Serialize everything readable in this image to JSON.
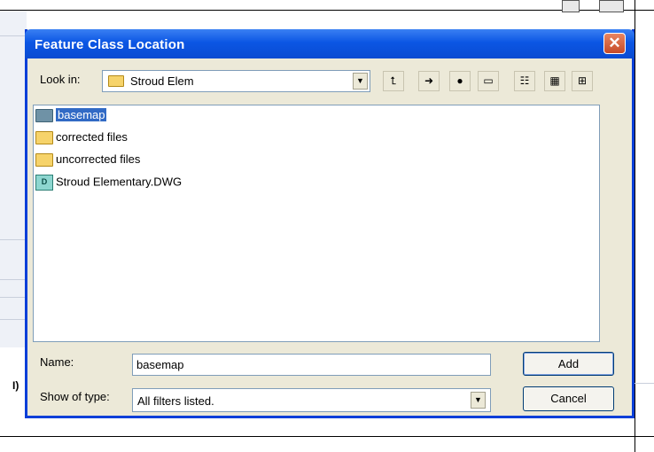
{
  "dialog": {
    "title": "Feature Class Location",
    "close_glyph": "✕"
  },
  "look_in": {
    "label": "Look in:",
    "value": "Stroud Elem",
    "icon": "folder-icon"
  },
  "toolbar": [
    {
      "name": "up-one-level-icon",
      "glyph": "⮤"
    },
    {
      "name": "connect-folder-icon",
      "glyph": "➜"
    },
    {
      "name": "disconnect-folder-icon",
      "glyph": "●"
    },
    {
      "name": "new-folder-icon",
      "glyph": "▭"
    },
    {
      "name": "list-view-icon",
      "glyph": "☷"
    },
    {
      "name": "details-view-icon",
      "glyph": "▦"
    },
    {
      "name": "thumbnails-view-icon",
      "glyph": "⊞"
    }
  ],
  "files": [
    {
      "name": "basemap",
      "type": "folder",
      "selected": true
    },
    {
      "name": "corrected files",
      "type": "folder",
      "selected": false
    },
    {
      "name": "uncorrected files",
      "type": "folder",
      "selected": false
    },
    {
      "name": "Stroud Elementary.DWG",
      "type": "dwg",
      "selected": false
    }
  ],
  "name_field": {
    "label": "Name:",
    "value": "basemap"
  },
  "type_field": {
    "label": "Show of type:",
    "value": "All filters listed."
  },
  "buttons": {
    "add": "Add",
    "cancel": "Cancel"
  },
  "background": {
    "side_glyph": "I)"
  },
  "colors": {
    "titlebar": "#0b56e4",
    "dialog_face": "#ece9d8",
    "selection": "#316ac5",
    "close_button": "#c64a28"
  }
}
